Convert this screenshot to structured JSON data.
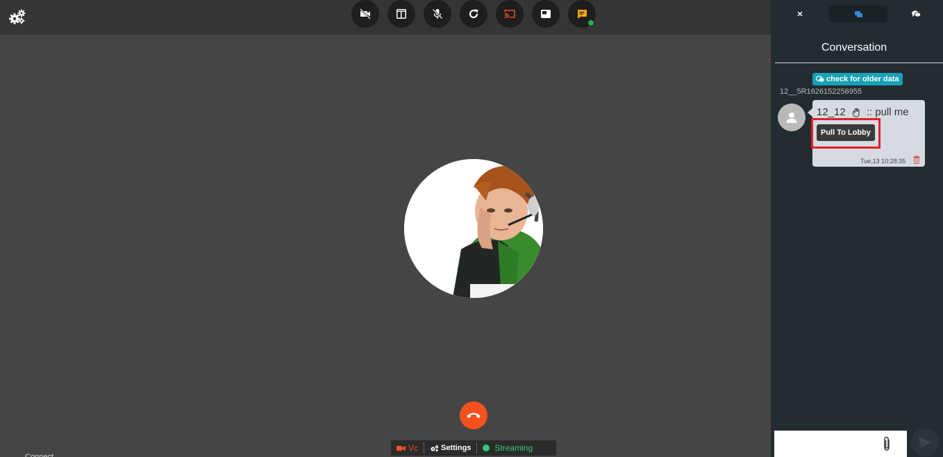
{
  "statusbar": {
    "vc_label": "Vc",
    "settings_label": "Settings",
    "streaming_label": "Streaming"
  },
  "panel": {
    "tabs": [
      "close",
      "chat",
      "conversations"
    ],
    "title": "Conversation",
    "older_button": "check for older data",
    "room_id": "12__5R1626152256955",
    "message": {
      "sender": "12_12",
      "text": ":: pull me",
      "action_button": "Pull To Lobby",
      "timestamp": "Tue,13 10:28:35"
    }
  },
  "bottom_text": "Connect",
  "icons": {
    "top_settings": "gears-icon",
    "controls": [
      "video-off-icon",
      "layout-icon",
      "mic-off-icon",
      "refresh-icon",
      "cast-icon",
      "picture-in-picture-icon",
      "chat-icon"
    ],
    "hangup": "phone-hangup-icon",
    "attach": "paperclip-icon",
    "send": "send-icon"
  },
  "colors": {
    "accent_orange": "#f4511e",
    "streaming_green": "#2ecc71",
    "info_teal": "#17a2b8",
    "highlight_red": "#e0202a"
  }
}
